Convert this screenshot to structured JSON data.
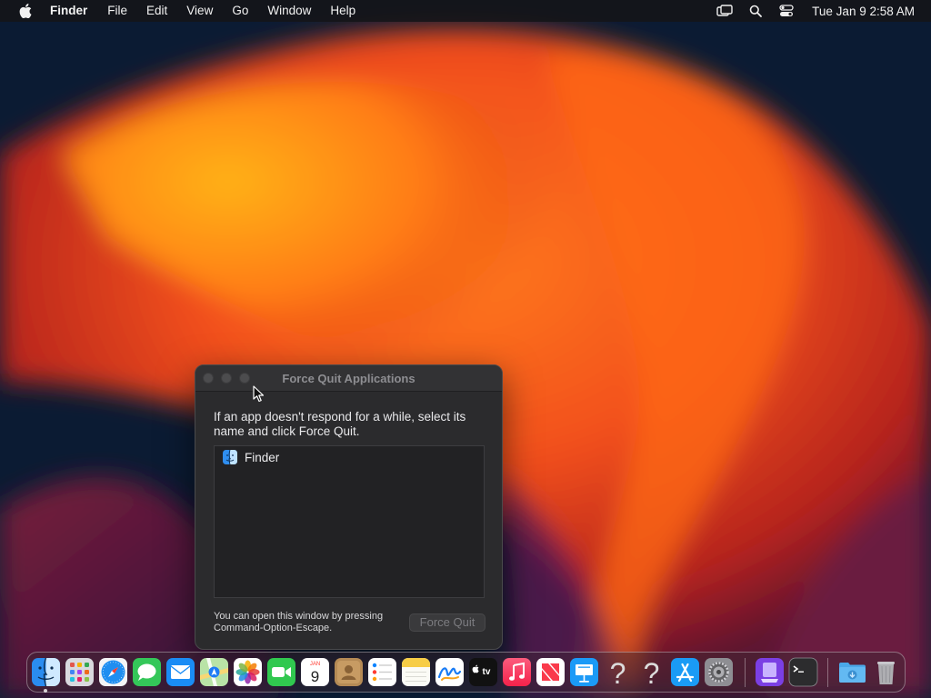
{
  "menubar": {
    "app_name": "Finder",
    "items": [
      "File",
      "Edit",
      "View",
      "Go",
      "Window",
      "Help"
    ],
    "clock": "Tue Jan 9  2:58 AM",
    "status_icons": [
      "screen-mirroring-icon",
      "spotlight-search-icon",
      "control-center-icon"
    ]
  },
  "force_quit": {
    "title": "Force Quit Applications",
    "instructions": "If an app doesn't respond for a while, select its name and click Force Quit.",
    "apps": [
      {
        "name": "Finder",
        "icon": "finder-icon"
      }
    ],
    "footnote": "You can open this window by pressing Command-Option-Escape.",
    "button_label": "Force Quit",
    "button_enabled": false
  },
  "dock": {
    "calendar": {
      "month": "JAN",
      "day": "9"
    },
    "tv_label": "tv",
    "items": [
      "finder",
      "launchpad",
      "safari",
      "messages",
      "mail",
      "maps",
      "photos",
      "facetime",
      "calendar",
      "contacts",
      "reminders",
      "notes",
      "freeform",
      "apple-tv",
      "music",
      "news",
      "keynote",
      "unknown-app",
      "unknown-app",
      "app-store",
      "system-settings",
      "simulator",
      "terminal",
      "downloads",
      "trash"
    ]
  },
  "colors": {
    "accent_orange": "#f06a1c",
    "wallpaper_dark": "#0b1b33",
    "window_bg": "#2b2b2d"
  }
}
